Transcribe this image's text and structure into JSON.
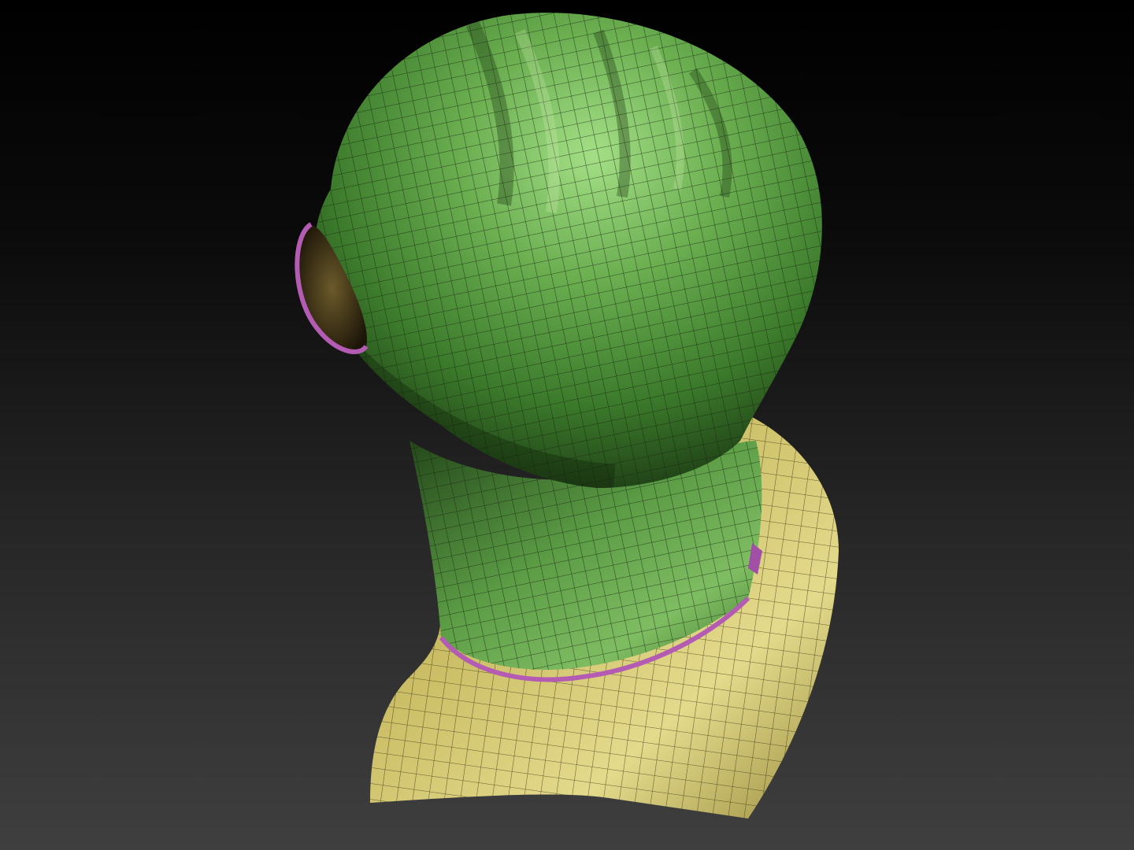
{
  "scene": {
    "subject": "balaclava-mask-sculpt",
    "display_mode": "polyframe-wireframe-overlay",
    "colors": {
      "background_top": "#000000",
      "background_bottom": "#3f3f3f",
      "mask_light": "#8fce72",
      "mask_mid": "#4a8a36",
      "mask_dark": "#1d3815",
      "shoulder_light": "#e3d98a",
      "shoulder_mid": "#b9ab55",
      "shoulder_dark": "#7a6e2c",
      "seam_trim": "#b45cb4",
      "wire": "#17210f"
    }
  }
}
